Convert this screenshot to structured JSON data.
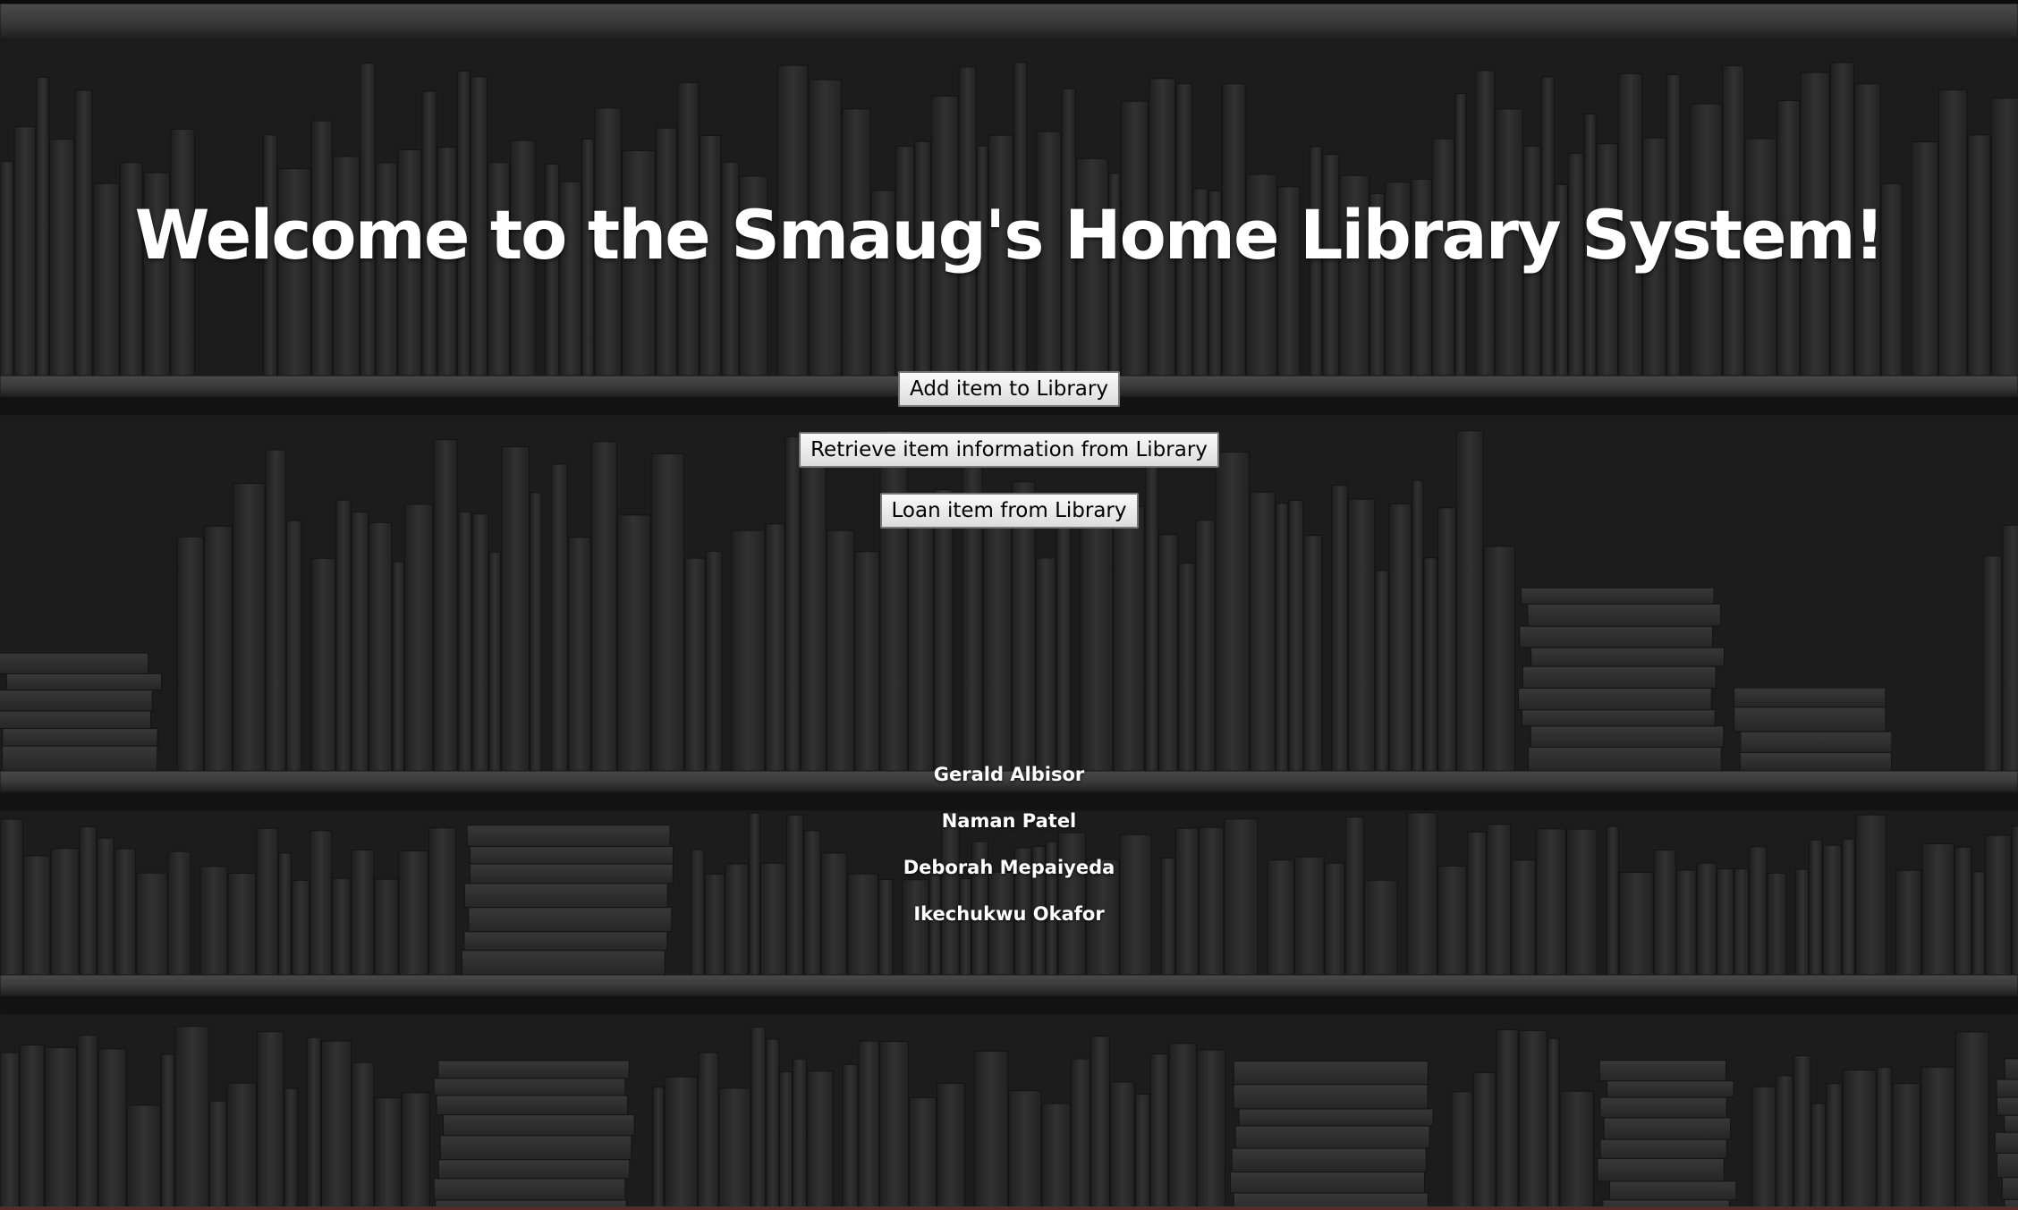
{
  "header": {
    "title": "Welcome to the Smaug's Home Library System!"
  },
  "menu": {
    "buttons": [
      {
        "label": "Add item to Library"
      },
      {
        "label": "Retrieve item information from Library"
      },
      {
        "label": "Loan item from Library"
      }
    ]
  },
  "credits": {
    "names": [
      "Gerald Albisor",
      "Naman Patel",
      "Deborah Mepaiyeda",
      "Ikechukwu Okafor"
    ]
  },
  "theme": {
    "background_color": "#1c1c1c",
    "shelf_color": "#3a3a3a",
    "book_color": "#2b2b2b",
    "text_color": "#ffffff",
    "button_color": "#e9e9e9"
  },
  "background": {
    "image_icon": "bookshelf-background"
  }
}
